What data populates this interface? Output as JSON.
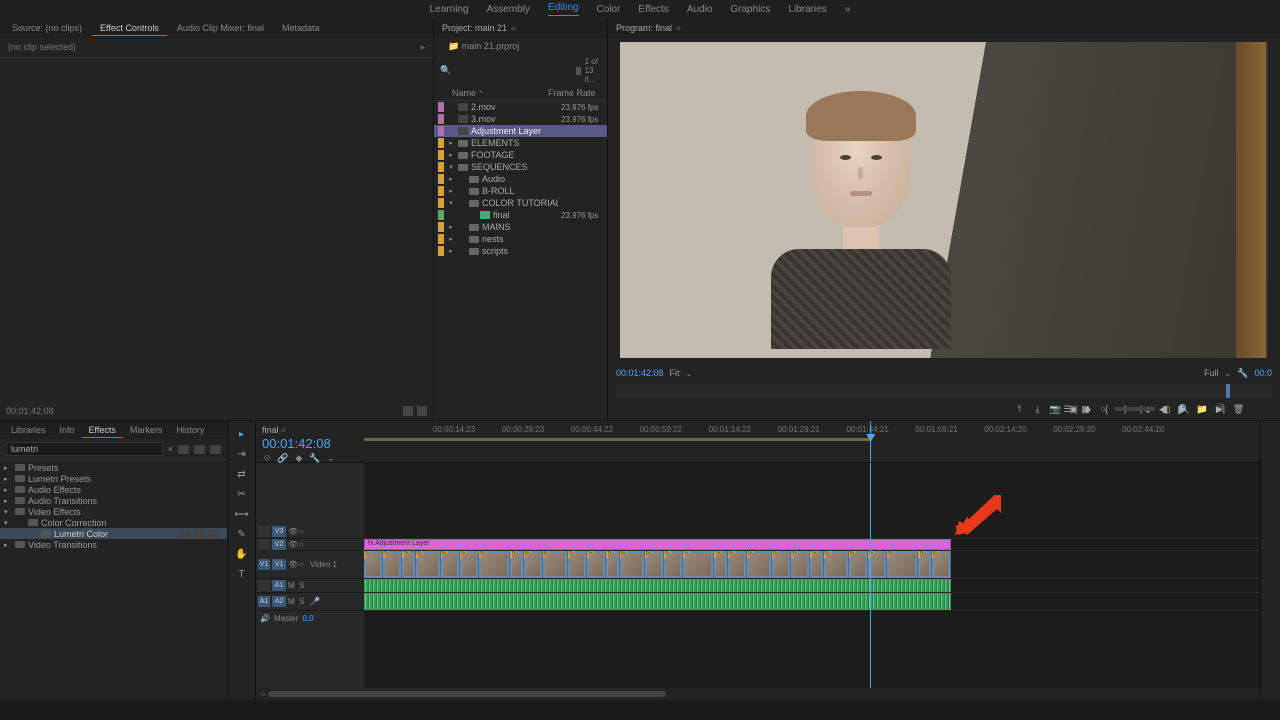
{
  "workspaces": [
    "Learning",
    "Assembly",
    "Editing",
    "Color",
    "Effects",
    "Audio",
    "Graphics",
    "Libraries"
  ],
  "workspace_active": "Editing",
  "source": {
    "tabs": [
      "Source: (no clips)",
      "Effect Controls",
      "Audio Clip Mixer: final",
      "Metadata"
    ],
    "active": "Effect Controls",
    "noclip": "(no clip selected)",
    "tc": "00;01;42;08"
  },
  "project": {
    "title": "Project: main 21",
    "crumb": "main 21.prproj",
    "count": "1 of 13 it...",
    "headers": {
      "name": "Name",
      "fr": "Frame Rate"
    },
    "items": [
      {
        "c": "#b070b0",
        "exp": "",
        "ind": 0,
        "type": "clip",
        "name": "2.mov",
        "fr": "23.976 fps"
      },
      {
        "c": "#b070b0",
        "exp": "",
        "ind": 0,
        "type": "clip",
        "name": "3.mov",
        "fr": "23.976 fps"
      },
      {
        "c": "#b070b0",
        "exp": "",
        "ind": 0,
        "type": "adj",
        "name": "Adjustment Layer",
        "fr": "",
        "sel": true
      },
      {
        "c": "#d9a040",
        "exp": "▸",
        "ind": 0,
        "type": "bin",
        "name": "ELEMENTS",
        "fr": ""
      },
      {
        "c": "#d9a040",
        "exp": "▸",
        "ind": 0,
        "type": "bin",
        "name": "FOOTAGE",
        "fr": ""
      },
      {
        "c": "#d9a040",
        "exp": "▾",
        "ind": 0,
        "type": "bin",
        "name": "SEQUENCES",
        "fr": ""
      },
      {
        "c": "#d9a040",
        "exp": "▸",
        "ind": 1,
        "type": "bin",
        "name": "Audio",
        "fr": ""
      },
      {
        "c": "#d9a040",
        "exp": "▸",
        "ind": 1,
        "type": "bin",
        "name": "B-ROLL",
        "fr": ""
      },
      {
        "c": "#d9a040",
        "exp": "▾",
        "ind": 1,
        "type": "bin",
        "name": "COLOR TUTORIAL",
        "fr": ""
      },
      {
        "c": "#5aaa5a",
        "exp": "",
        "ind": 2,
        "type": "seq",
        "name": "final",
        "fr": "23.976 fps"
      },
      {
        "c": "#d9a040",
        "exp": "▸",
        "ind": 1,
        "type": "bin",
        "name": "MAINS",
        "fr": ""
      },
      {
        "c": "#d9a040",
        "exp": "▸",
        "ind": 1,
        "type": "bin",
        "name": "nests",
        "fr": ""
      },
      {
        "c": "#d9a040",
        "exp": "▸",
        "ind": 1,
        "type": "bin",
        "name": "scripts",
        "fr": ""
      }
    ]
  },
  "program": {
    "title": "Program: final",
    "tc": "00:01:42:08",
    "fit": "Fit",
    "full": "Full",
    "end_tc": "00:0"
  },
  "effects": {
    "tabs": [
      "Libraries",
      "Info",
      "Effects",
      "Markers",
      "History"
    ],
    "active": "Effects",
    "search": "lumetri",
    "tree": [
      {
        "exp": "▸",
        "ind": 0,
        "name": "Presets"
      },
      {
        "exp": "▸",
        "ind": 0,
        "name": "Lumetri Presets"
      },
      {
        "exp": "▸",
        "ind": 0,
        "name": "Audio Effects"
      },
      {
        "exp": "▸",
        "ind": 0,
        "name": "Audio Transitions"
      },
      {
        "exp": "▾",
        "ind": 0,
        "name": "Video Effects"
      },
      {
        "exp": "▾",
        "ind": 1,
        "name": "Color Correction"
      },
      {
        "exp": "",
        "ind": 2,
        "name": "Lumetri Color",
        "sel": true,
        "badges": true
      },
      {
        "exp": "▸",
        "ind": 0,
        "name": "Video Transitions"
      }
    ]
  },
  "timeline": {
    "seq": "final",
    "tc": "00:01:42:08",
    "ruler": [
      "",
      "00:00:14:23",
      "00:00:29:23",
      "00:00:44:22",
      "00:00:59:22",
      "00:01:14:22",
      "00:01:29:21",
      "00:01:44:21",
      "00:01:59:21",
      "00:02:14:20",
      "00:02:29:20",
      "00:02:44:20",
      ""
    ],
    "tracks": {
      "v3": "V3",
      "v2": "V2",
      "v1": "V1",
      "a1": "A1",
      "a2": "A2",
      "v1name": "Video 1",
      "master": "Master",
      "db": "0.0"
    },
    "adj_label": "fx  Adjustment Layer",
    "clip_widths": [
      3,
      3,
      2,
      4,
      3,
      3,
      5,
      2,
      3,
      4,
      3,
      3,
      2,
      4,
      3,
      3,
      5,
      2,
      3,
      4,
      3,
      3,
      2,
      4,
      3,
      3,
      5,
      2,
      3
    ]
  }
}
